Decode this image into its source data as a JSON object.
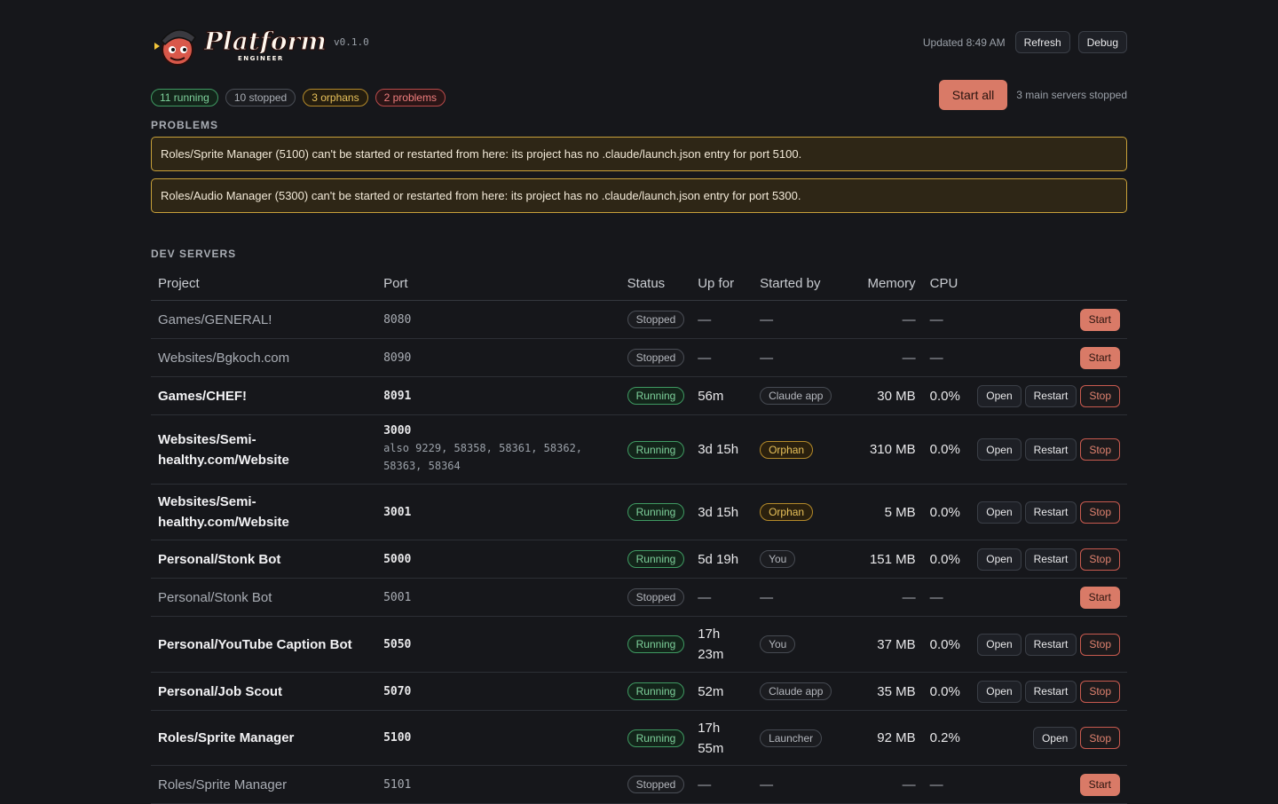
{
  "header": {
    "logo_text": "Platform",
    "logo_sub": "ENGINEER",
    "version": "v0.1.0",
    "updated": "Updated 8:49 AM",
    "refresh_label": "Refresh",
    "debug_label": "Debug"
  },
  "summary": {
    "running": "11 running",
    "stopped": "10 stopped",
    "orphans": "3 orphans",
    "problems": "2 problems",
    "start_all_label": "Start all",
    "note": "3 main servers stopped"
  },
  "problems": {
    "title": "PROBLEMS",
    "items": [
      "Roles/Sprite Manager (5100) can't be started or restarted from here: its project has no .claude/launch.json entry for port 5100.",
      "Roles/Audio Manager (5300) can't be started or restarted from here: its project has no .claude/launch.json entry for port 5300."
    ]
  },
  "dev_servers": {
    "title": "DEV SERVERS",
    "columns": {
      "project": "Project",
      "port": "Port",
      "status": "Status",
      "upfor": "Up for",
      "startedby": "Started by",
      "memory": "Memory",
      "cpu": "CPU"
    },
    "labels": {
      "open": "Open",
      "restart": "Restart",
      "stop": "Stop",
      "start": "Start",
      "dash": "—"
    },
    "rows": [
      {
        "project": "Games/GENERAL!",
        "port": "8080",
        "status": "Stopped"
      },
      {
        "project": "Websites/Bgkoch.com",
        "port": "8090",
        "status": "Stopped"
      },
      {
        "project": "Games/CHEF!",
        "port": "8091",
        "status": "Running",
        "upfor": "56m",
        "startedby": "Claude app",
        "memory": "30 MB",
        "cpu": "0.0%"
      },
      {
        "project": "Websites/Semi-healthy.com/Website",
        "port": "3000",
        "also": "also 9229, 58358, 58361, 58362, 58363, 58364",
        "status": "Running",
        "upfor": "3d 15h",
        "startedby": "Orphan",
        "memory": "310 MB",
        "cpu": "0.0%"
      },
      {
        "project": "Websites/Semi-healthy.com/Website",
        "port": "3001",
        "status": "Running",
        "upfor": "3d 15h",
        "startedby": "Orphan",
        "memory": "5 MB",
        "cpu": "0.0%"
      },
      {
        "project": "Personal/Stonk Bot",
        "port": "5000",
        "status": "Running",
        "upfor": "5d 19h",
        "startedby": "You",
        "memory": "151 MB",
        "cpu": "0.0%"
      },
      {
        "project": "Personal/Stonk Bot",
        "port": "5001",
        "status": "Stopped"
      },
      {
        "project": "Personal/YouTube Caption Bot",
        "port": "5050",
        "status": "Running",
        "upfor": "17h 23m",
        "startedby": "You",
        "memory": "37 MB",
        "cpu": "0.0%"
      },
      {
        "project": "Personal/Job Scout",
        "port": "5070",
        "status": "Running",
        "upfor": "52m",
        "startedby": "Claude app",
        "memory": "35 MB",
        "cpu": "0.0%"
      },
      {
        "project": "Roles/Sprite Manager",
        "port": "5100",
        "status": "Running",
        "upfor": "17h 55m",
        "startedby": "Launcher",
        "memory": "92 MB",
        "cpu": "0.2%",
        "no_restart": true
      },
      {
        "project": "Roles/Sprite Manager",
        "port": "5101",
        "status": "Stopped"
      }
    ]
  },
  "colors": {
    "background": "#16171b",
    "accent": "#d97a67",
    "running": "#7ed19b",
    "orphan": "#e8c15a",
    "problem_border": "#c9a13a"
  }
}
